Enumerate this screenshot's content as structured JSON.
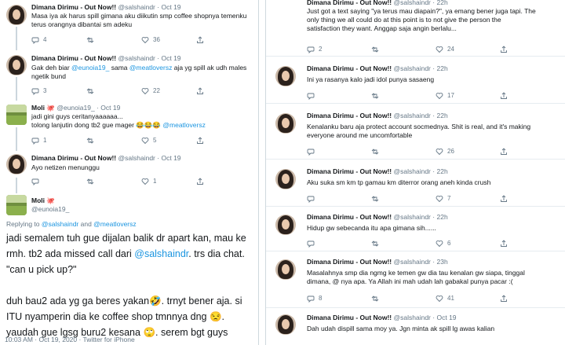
{
  "left": {
    "tweets": [
      {
        "name": "Dimana Dirimu - Out Now!!",
        "handle": "@salshaindr",
        "time": "Oct 19",
        "lines": [
          "Masa iya ak harus spill gimana aku diikutin smp coffee shopnya temenku",
          "terus orangnya dibantai sm adeku"
        ],
        "reply": "4",
        "retweet": "",
        "like": "36"
      },
      {
        "name": "Dimana Dirimu - Out Now!!",
        "handle": "@salshaindr",
        "time": "Oct 19",
        "line1_pre": "Gak deh biar ",
        "mention1": "@eunoia19_",
        "line1_mid": " sama ",
        "mention2": "@meatloversz",
        "line1_post": " aja yg spill ak udh males",
        "line2": "ngetik bund",
        "reply": "3",
        "retweet": "",
        "like": "22"
      },
      {
        "name": "Moli",
        "name_icon": "🐙",
        "handle": "@eunoia19_",
        "time": "Oct 19",
        "line1": "jadi gini guys ceritanyaaaaaa...",
        "line2_pre": "tolong lanjutin dong tb2 gue mager 😂😂😂 ",
        "mention": "@meatloversz",
        "reply": "1",
        "retweet": "",
        "like": "5"
      },
      {
        "name": "Dimana Dirimu - Out Now!!",
        "handle": "@salshaindr",
        "time": "Oct 19",
        "line1": "Ayo netizen menunggu",
        "reply": "",
        "retweet": "",
        "like": "1"
      },
      {
        "name": "Moli",
        "name_icon": "🐙",
        "handle": "@eunoia19_"
      }
    ],
    "replying": {
      "pre": "Replying to ",
      "m1": "@salshaindr",
      "mid": " and ",
      "m2": "@meatloversz"
    },
    "big_lines": [
      {
        "t": "jadi semalem tuh gue dijalan balik dr apart kan, mau ke"
      },
      {
        "pre": "rmh. tb2 ada missed call dari ",
        "m": "@salshaindr",
        "post": ". trs dia chat."
      },
      {
        "t": "\"can u pick up?\""
      },
      {
        "t": ""
      },
      {
        "t": "duh bau2 ada yg ga beres yakan🤣. trnyt bener aja. si"
      },
      {
        "t": "ITU nyamperin dia ke coffee shop tmnnya dng 😒."
      },
      {
        "t": "yaudah gue lgsg buru2 kesana 🙄. serem bgt guys"
      }
    ],
    "footer": "10:03 AM · Oct 19, 2020 · Twitter for iPhone"
  },
  "right": {
    "top_tweet": {
      "name": "Dimana Dirimu - Out Now!!",
      "handle": "@salshaindr",
      "time": "22h",
      "lines": [
        "Just got a text saying \"ya terus mau diapain?\", ya emang bener juga tapi. The",
        "only thing we all could do at this point is to not give the person the",
        "satisfaction they want. Anggap saja angin berlalu..."
      ],
      "reply": "2",
      "retweet": "",
      "like": "24"
    },
    "tweets": [
      {
        "name": "Dimana Dirimu - Out Now!!",
        "handle": "@salshaindr",
        "time": "22h",
        "lines": [
          "Ini ya rasanya kalo jadi idol punya sasaeng"
        ],
        "reply": "",
        "retweet": "",
        "like": "17"
      },
      {
        "name": "Dimana Dirimu - Out Now!!",
        "handle": "@salshaindr",
        "time": "22h",
        "lines": [
          "Kenalanku baru aja protect account socmednya. Shit is real, and it's making",
          "everyone around me uncomfortable"
        ],
        "reply": "",
        "retweet": "",
        "like": "26"
      },
      {
        "name": "Dimana Dirimu - Out Now!!",
        "handle": "@salshaindr",
        "time": "22h",
        "lines": [
          "Aku suka sm km tp gamau km diterror orang aneh kinda crush"
        ],
        "reply": "",
        "retweet": "",
        "like": "7"
      },
      {
        "name": "Dimana Dirimu - Out Now!!",
        "handle": "@salshaindr",
        "time": "22h",
        "lines": [
          "Hidup gw sebecanda itu apa gimana sih......"
        ],
        "reply": "",
        "retweet": "",
        "like": "6"
      },
      {
        "name": "Dimana Dirimu - Out Now!!",
        "handle": "@salshaindr",
        "time": "23h",
        "lines": [
          "Masalahnya smp dia ngmg ke temen gw dia tau kenalan gw siapa, tinggal",
          "dimana, @ nya apa. Ya Allah ini mah udah lah gabakal punya pacar :("
        ],
        "reply": "8",
        "retweet": "",
        "like": "41"
      },
      {
        "name": "Dimana Dirimu - Out Now!!",
        "handle": "@salshaindr",
        "time": "Oct 19",
        "lines": [
          "Dah udah dispill sama moy ya. Jgn minta ak spill lg awas kalian"
        ],
        "reply": "",
        "retweet": "",
        "like": ""
      }
    ]
  }
}
